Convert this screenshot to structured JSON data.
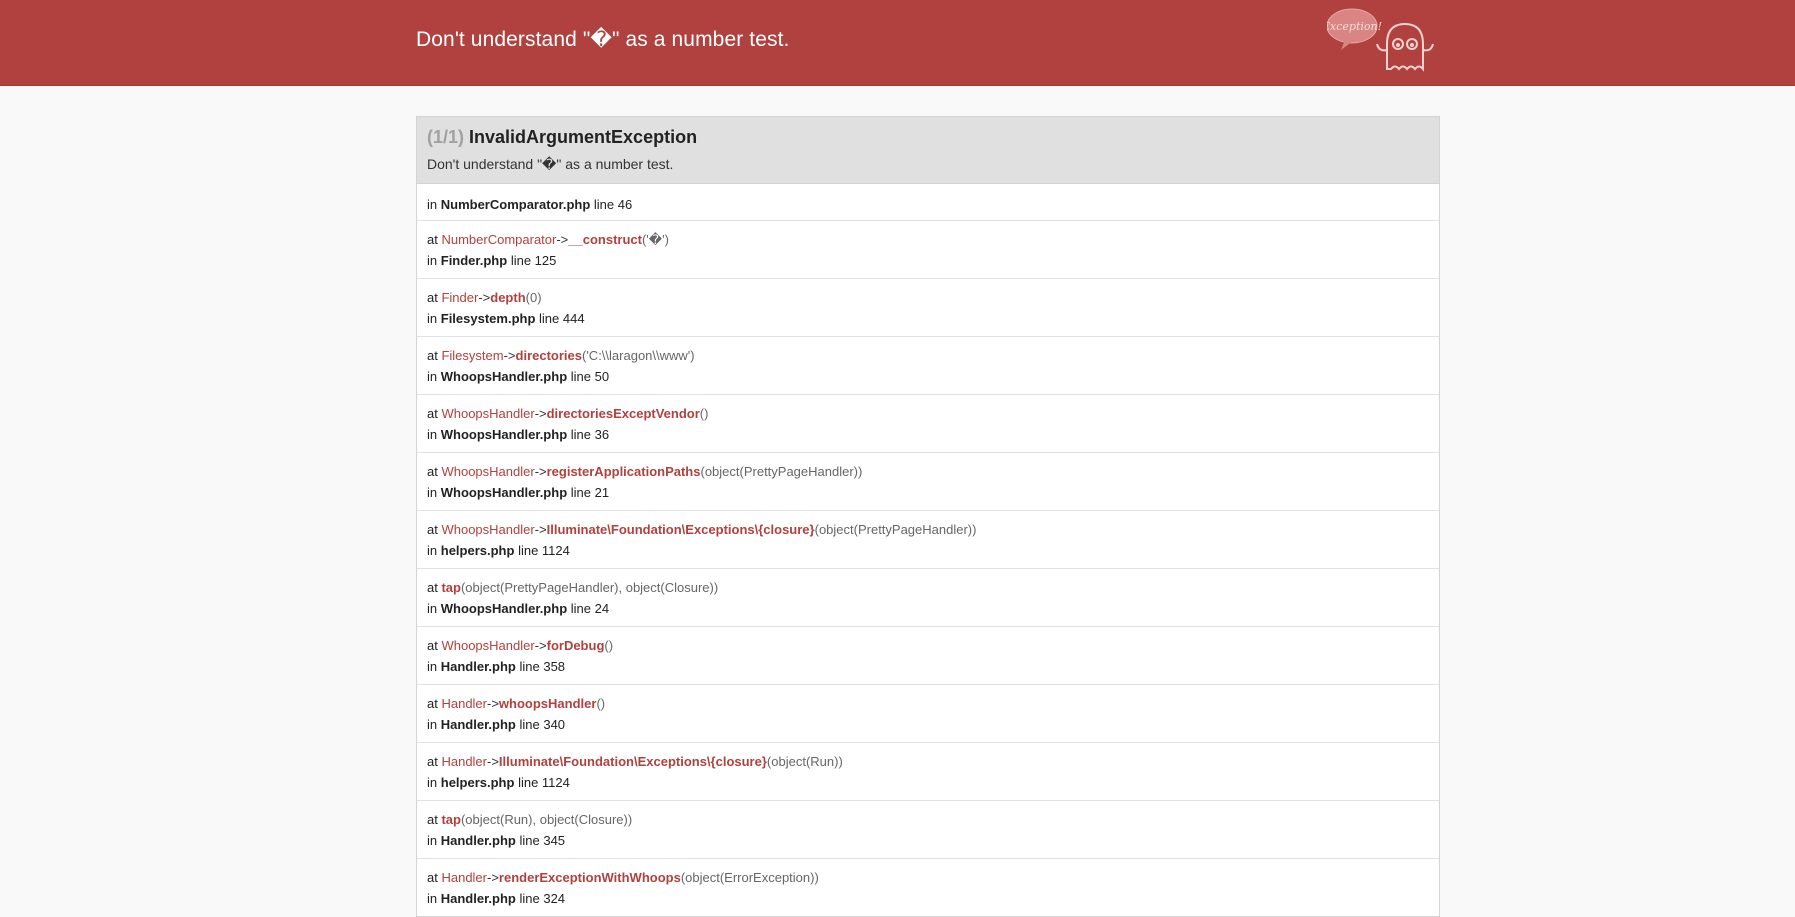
{
  "header": {
    "title": "Don't understand \"�\" as a number test.",
    "mascot_label": "Exception!"
  },
  "exception": {
    "count": "(1/1)",
    "class": "InvalidArgumentException",
    "message": "Don't understand \"�\" as a number test."
  },
  "location": {
    "in": "in",
    "file": "NumberComparator.php",
    "line": "line 46"
  },
  "frames": [
    {
      "at": "at",
      "cls": "NumberComparator",
      "arrow": "->",
      "fn": "__construct",
      "args": "('�')",
      "in": "in",
      "file": "Finder.php",
      "line": "line 125"
    },
    {
      "at": "at",
      "cls": "Finder",
      "arrow": "->",
      "fn": "depth",
      "args": "(0)",
      "in": "in",
      "file": "Filesystem.php",
      "line": "line 444"
    },
    {
      "at": "at",
      "cls": "Filesystem",
      "arrow": "->",
      "fn": "directories",
      "args": "('C:\\\\laragon\\\\www')",
      "in": "in",
      "file": "WhoopsHandler.php",
      "line": "line 50"
    },
    {
      "at": "at",
      "cls": "WhoopsHandler",
      "arrow": "->",
      "fn": "directoriesExceptVendor",
      "args": "()",
      "in": "in",
      "file": "WhoopsHandler.php",
      "line": "line 36"
    },
    {
      "at": "at",
      "cls": "WhoopsHandler",
      "arrow": "->",
      "fn": "registerApplicationPaths",
      "args": "(object(PrettyPageHandler))",
      "in": "in",
      "file": "WhoopsHandler.php",
      "line": "line 21"
    },
    {
      "at": "at",
      "cls": "WhoopsHandler",
      "arrow": "->",
      "fn": "Illuminate\\Foundation\\Exceptions\\{closure}",
      "args": "(object(PrettyPageHandler))",
      "in": "in",
      "file": "helpers.php",
      "line": "line 1124"
    },
    {
      "at": "at",
      "cls": "",
      "arrow": "",
      "fn": "tap",
      "args": "(object(PrettyPageHandler), object(Closure))",
      "in": "in",
      "file": "WhoopsHandler.php",
      "line": "line 24"
    },
    {
      "at": "at",
      "cls": "WhoopsHandler",
      "arrow": "->",
      "fn": "forDebug",
      "args": "()",
      "in": "in",
      "file": "Handler.php",
      "line": "line 358"
    },
    {
      "at": "at",
      "cls": "Handler",
      "arrow": "->",
      "fn": "whoopsHandler",
      "args": "()",
      "in": "in",
      "file": "Handler.php",
      "line": "line 340"
    },
    {
      "at": "at",
      "cls": "Handler",
      "arrow": "->",
      "fn": "Illuminate\\Foundation\\Exceptions\\{closure}",
      "args": "(object(Run))",
      "in": "in",
      "file": "helpers.php",
      "line": "line 1124"
    },
    {
      "at": "at",
      "cls": "",
      "arrow": "",
      "fn": "tap",
      "args": "(object(Run), object(Closure))",
      "in": "in",
      "file": "Handler.php",
      "line": "line 345"
    },
    {
      "at": "at",
      "cls": "Handler",
      "arrow": "->",
      "fn": "renderExceptionWithWhoops",
      "args": "(object(ErrorException))",
      "in": "in",
      "file": "Handler.php",
      "line": "line 324"
    }
  ]
}
